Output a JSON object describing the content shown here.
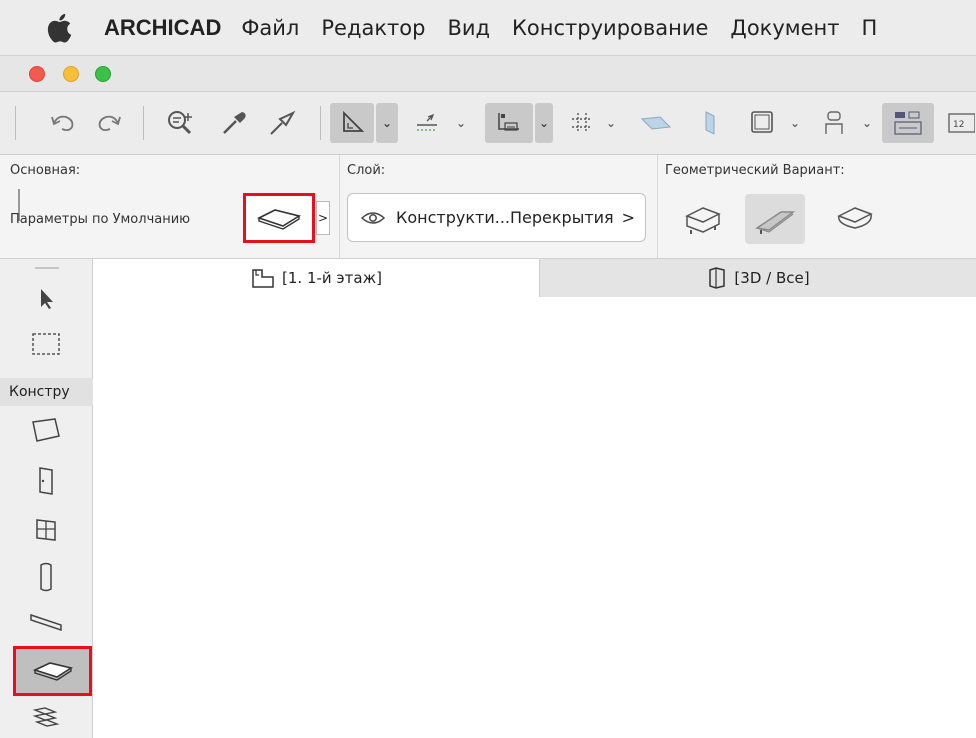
{
  "menubar": {
    "items": [
      "ARCHICAD",
      "Файл",
      "Редактор",
      "Вид",
      "Конструирование",
      "Документ",
      "П"
    ]
  },
  "infobox": {
    "main_label": "Основная:",
    "defaults_label": "Параметры по Умолчанию",
    "layer_label": "Слой:",
    "layer_value": "Конструкти...Перекрытия",
    "layer_arrow": ">",
    "geometry_label": "Геометрический Вариант:",
    "slab_arrow": ">"
  },
  "tabs": [
    {
      "label": "[1. 1-й этаж]"
    },
    {
      "label": "[3D / Все]"
    }
  ],
  "toolbox": {
    "section_label": "Констру"
  },
  "colors": {
    "highlight": "#e8101b"
  }
}
